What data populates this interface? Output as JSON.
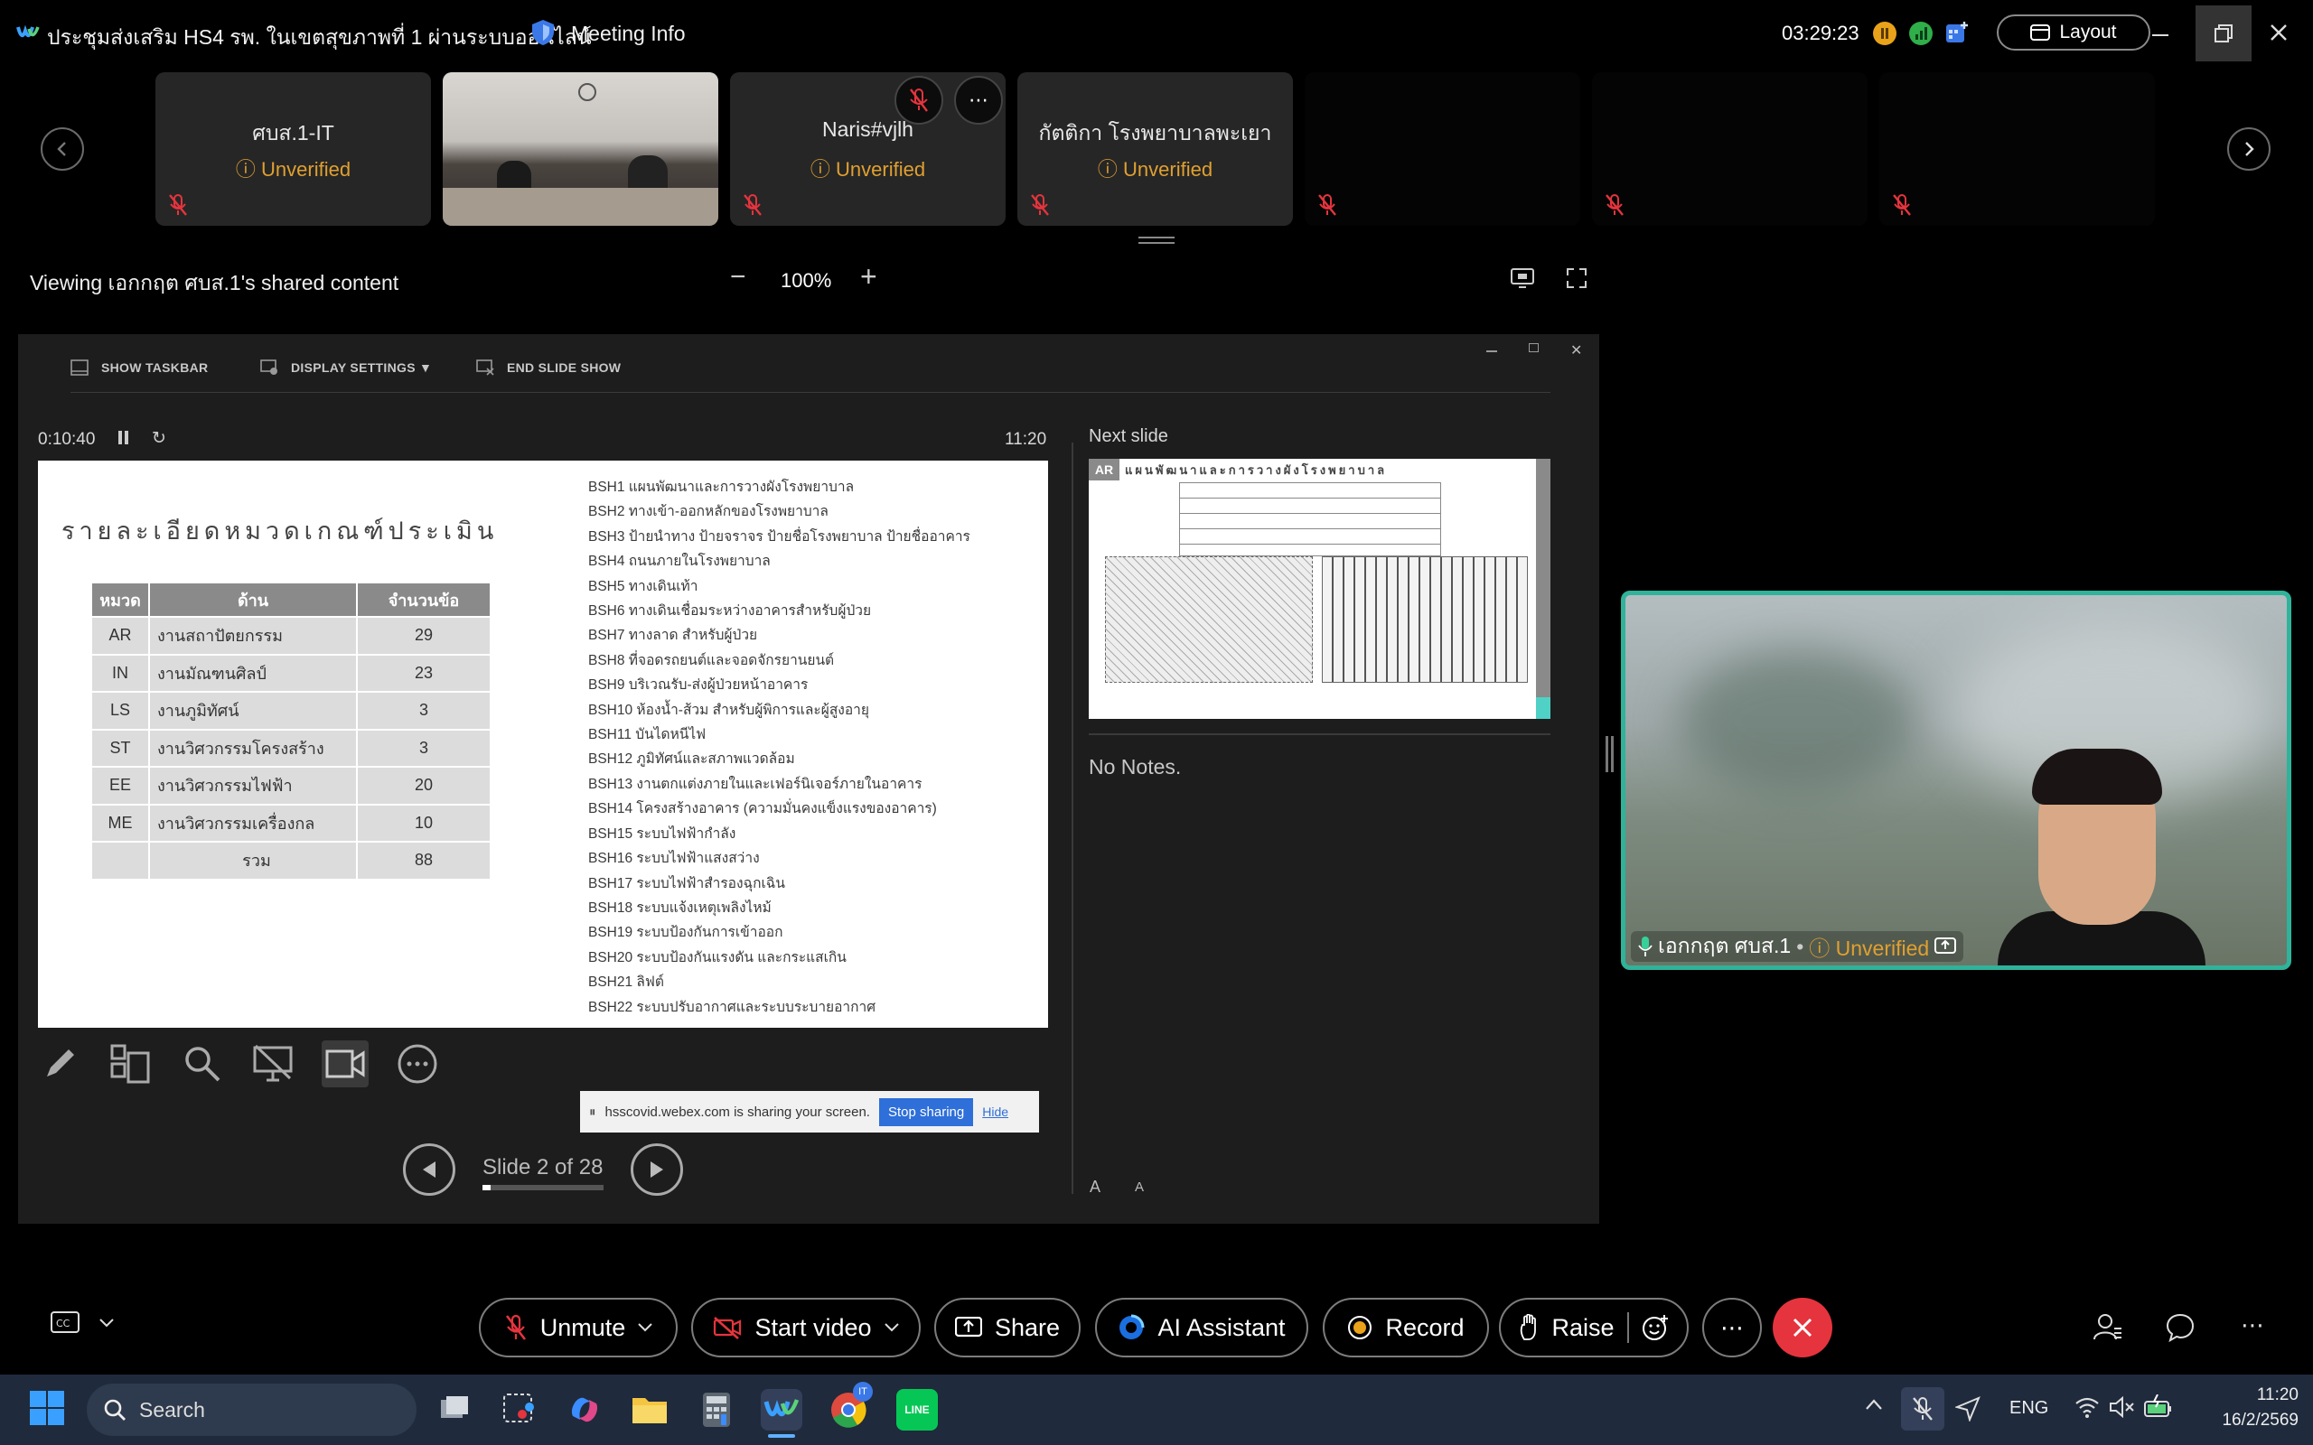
{
  "titlebar": {
    "app_title": "ประชุมส่งเสริม HS4 รพ. ในเขตสุขภาพที่ 1 ผ่านระบบออนไลน์",
    "meeting_info": "Meeting Info",
    "clock": "03:29:23",
    "layout_label": "Layout"
  },
  "participants": [
    {
      "name": "ศบส.1-IT",
      "status": "Unverified"
    },
    {
      "name": "",
      "status": ""
    },
    {
      "name": "Naris#vjlh",
      "status": "Unverified"
    },
    {
      "name": "กัตติกา โรงพยาบาลพะเยา",
      "status": "Unverified"
    },
    {
      "name": "",
      "status": ""
    },
    {
      "name": "",
      "status": ""
    },
    {
      "name": "",
      "status": ""
    }
  ],
  "share": {
    "viewing_text": "Viewing เอกกฤต ศบส.1's shared content",
    "zoom_level": "100%"
  },
  "presenter": {
    "toolbar": {
      "show_taskbar": "SHOW TASKBAR",
      "display_settings": "DISPLAY SETTINGS ▼",
      "end_show": "END SLIDE SHOW"
    },
    "elapsed": "0:10:40",
    "time": "11:20",
    "next_slide_label": "Next slide",
    "notes": "No Notes.",
    "slide_counter": "Slide 2 of 28",
    "slide_progress": 0.07,
    "sharing_text": "hsscovid.webex.com is sharing your screen.",
    "stop_sharing": "Stop sharing",
    "hide": "Hide"
  },
  "slide": {
    "title": "รายละเอียดหมวดเกณฑ์ประเมิน",
    "table_headers": [
      "หมวด",
      "ด้าน",
      "จำนวนข้อ"
    ],
    "rows": [
      [
        "AR",
        "งานสถาปัตยกรรม",
        "29"
      ],
      [
        "IN",
        "งานมัณฑนศิลป์",
        "23"
      ],
      [
        "LS",
        "งานภูมิทัศน์",
        "3"
      ],
      [
        "ST",
        "งานวิศวกรรมโครงสร้าง",
        "3"
      ],
      [
        "EE",
        "งานวิศวกรรมไฟฟ้า",
        "20"
      ],
      [
        "ME",
        "งานวิศวกรรมเครื่องกล",
        "10"
      ],
      [
        "",
        "รวม",
        "88"
      ]
    ],
    "bsh_list": [
      "BSH1 แผนพัฒนาและการวางผังโรงพยาบาล",
      "BSH2 ทางเข้า-ออกหลักของโรงพยาบาล",
      "BSH3 ป้ายนำทาง ป้ายจราจร ป้ายชื่อโรงพยาบาล ป้ายชื่ออาคาร",
      "BSH4 ถนนภายในโรงพยาบาล",
      "BSH5 ทางเดินเท้า",
      "BSH6 ทางเดินเชื่อมระหว่างอาคารสำหรับผู้ป่วย",
      "BSH7 ทางลาด สำหรับผู้ป่วย",
      "BSH8 ที่จอดรถยนต์และจอดจักรยานยนต์",
      "BSH9 บริเวณรับ-ส่งผู้ป่วยหน้าอาคาร",
      "BSH10 ห้องน้ำ-ส้วม สำหรับผู้พิการและผู้สูงอายุ",
      "BSH11 บันไดหนีไฟ",
      "BSH12 ภูมิทัศน์และสภาพแวดล้อม",
      "BSH13 งานตกแต่งภายในและเฟอร์นิเจอร์ภายในอาคาร",
      "BSH14 โครงสร้างอาคาร (ความมั่นคงแข็งแรงของอาคาร)",
      "BSH15 ระบบไฟฟ้ากำลัง",
      "BSH16 ระบบไฟฟ้าแสงสว่าง",
      "BSH17 ระบบไฟฟ้าสำรองฉุกเฉิน",
      "BSH18 ระบบแจ้งเหตุเพลิงไหม้",
      "BSH19 ระบบป้องกันการเข้าออก",
      "BSH20 ระบบป้องกันแรงดัน และกระแสเกิน",
      "BSH21 ลิฟต์",
      "BSH22 ระบบปรับอากาศและระบบระบายอากาศ"
    ]
  },
  "next_slide": {
    "badge": "AR",
    "title": "แผนพัฒนาและการวางผังโรงพยาบาล"
  },
  "self_video": {
    "name": "เอกกฤต ศบส.1",
    "status": "Unverified"
  },
  "controls": {
    "unmute": "Unmute",
    "start_video": "Start video",
    "share": "Share",
    "ai_assistant": "AI Assistant",
    "record": "Record",
    "raise": "Raise"
  },
  "taskbar": {
    "search": "Search",
    "lang": "ENG",
    "time": "11:20",
    "date": "16/2/2569",
    "chrome_badge": "IT",
    "line_label": "LINE"
  },
  "colors": {
    "accent_blue": "#3b78e7",
    "unverified": "#e0a030",
    "end_red": "#e5343e",
    "speaker_border": "#2fb39a"
  }
}
